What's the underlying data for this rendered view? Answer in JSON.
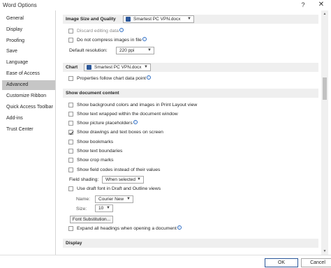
{
  "window": {
    "title": "Word Options",
    "help_label": "?",
    "close_label": "✕"
  },
  "sidebar": {
    "items": [
      {
        "label": "General"
      },
      {
        "label": "Display"
      },
      {
        "label": "Proofing"
      },
      {
        "label": "Save"
      },
      {
        "label": "Language"
      },
      {
        "label": "Ease of Access"
      },
      {
        "label": "Advanced",
        "selected": true
      },
      {
        "label": "Customize Ribbon"
      },
      {
        "label": "Quick Access Toolbar"
      },
      {
        "label": "Add-ins"
      },
      {
        "label": "Trust Center"
      }
    ]
  },
  "image_size": {
    "header": "Image Size and Quality",
    "document": "Smartest PC VPN.docx",
    "discard_editing": "Discard editing data",
    "no_compress": "Do not compress images in file",
    "default_resolution_label": "Default resolution:",
    "default_resolution_value": "220 ppi"
  },
  "chart": {
    "header": "Chart",
    "document": "Smartest PC VPN.docx",
    "properties_follow": "Properties follow chart data point"
  },
  "show_doc": {
    "header": "Show document content",
    "items": [
      {
        "label": "Show background colors and images in Print Layout view",
        "checked": false
      },
      {
        "label": "Show text wrapped within the document window",
        "checked": false
      },
      {
        "label": "Show picture placeholders",
        "checked": false
      },
      {
        "label": "Show drawings and text boxes on screen",
        "checked": true
      },
      {
        "label": "Show bookmarks",
        "checked": false
      },
      {
        "label": "Show text boundaries",
        "checked": false
      },
      {
        "label": "Show crop marks",
        "checked": false
      },
      {
        "label": "Show field codes instead of their values",
        "checked": false
      }
    ],
    "field_shading_label": "Field shading:",
    "field_shading_value": "When selected",
    "use_draft_font": "Use draft font in Draft and Outline views",
    "name_label": "Name:",
    "name_value": "Courier New",
    "size_label": "Size:",
    "size_value": "10",
    "font_substitution": "Font Substitution...",
    "expand_headings": "Expand all headings when opening a document"
  },
  "display": {
    "header": "Display"
  },
  "footer": {
    "ok_label": "OK",
    "cancel_label": "Cancel"
  },
  "colors": {
    "accent": "#2b579a",
    "selected_nav": "#c6c6c6",
    "section_bg": "#efefef"
  }
}
